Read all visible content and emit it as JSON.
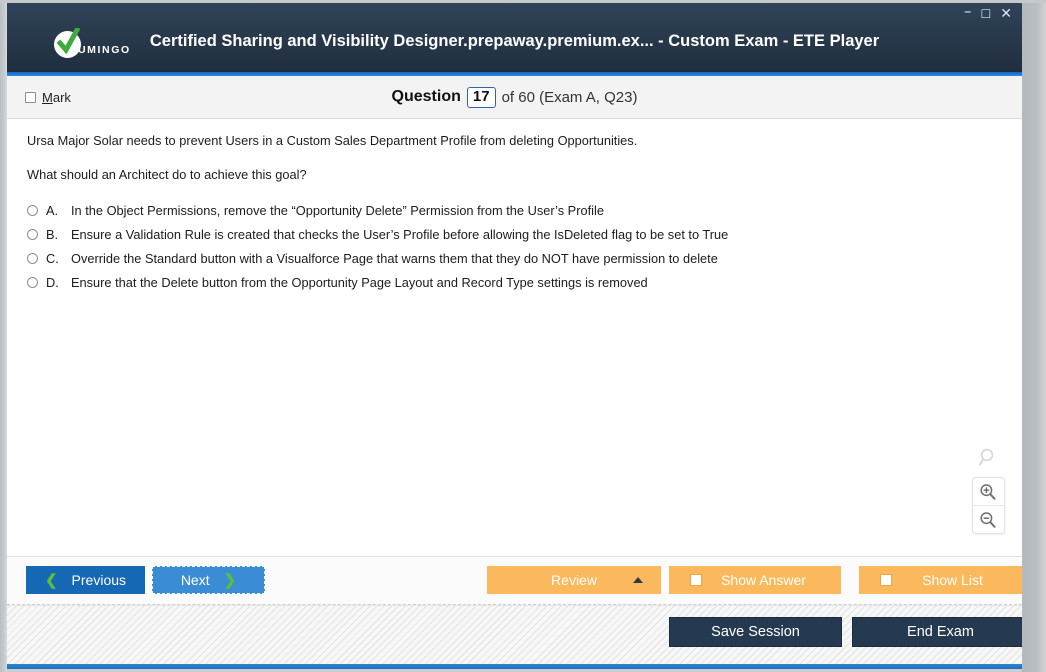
{
  "window": {
    "title": "Certified Sharing and Visibility Designer.prepaway.premium.ex... - Custom Exam - ETE Player",
    "logo_text": "UMINGO",
    "controls": {
      "minimize": "–",
      "maximize": "☐",
      "close": "✕"
    }
  },
  "header": {
    "mark_label_prefix": "M",
    "mark_label_rest": "ark",
    "question_word": "Question",
    "question_number": "17",
    "question_rest": "of 60 (Exam A, Q23)"
  },
  "question": {
    "stem_lines": [
      "Ursa Major Solar needs to prevent Users in a Custom Sales Department Profile from deleting Opportunities.",
      "What should an Architect do to achieve this goal?"
    ],
    "options": [
      {
        "letter": "A.",
        "text": "In the Object Permissions, remove the “Opportunity Delete” Permission from the User’s Profile",
        "selected": false
      },
      {
        "letter": "B.",
        "text": "Ensure a Validation Rule is created that checks the User’s Profile before allowing the IsDeleted flag to be set to True",
        "selected": false
      },
      {
        "letter": "C.",
        "text": "Override the Standard button with a Visualforce Page that warns them that they do NOT have permission to delete",
        "selected": false
      },
      {
        "letter": "D.",
        "text": "Ensure that the Delete button from the Opportunity Page Layout and Record Type settings is removed",
        "selected": false
      }
    ]
  },
  "zoom_tools": {
    "search_icon": "magnifier-icon",
    "zoom_in_icon": "magnifier-plus-icon",
    "zoom_out_icon": "magnifier-minus-icon"
  },
  "toolbar": {
    "previous_label": "Previous",
    "previous_chevron": "❮",
    "next_label": "Next",
    "next_chevron": "❯",
    "review_label": "Review",
    "show_answer_label": "Show Answer",
    "show_list_label": "Show List",
    "show_answer_checked": false,
    "show_list_checked": false
  },
  "statusbar": {
    "save_session_label": "Save Session",
    "end_exam_label": "End Exam"
  },
  "colors": {
    "titlebar_dark": "#2a3b4e",
    "accent_blue": "#1f7ad6",
    "primary_blue": "#1568b4",
    "next_blue": "#3a8dd5",
    "orange": "#fbb85c",
    "green_chevron": "#5bbf3b",
    "dark_navy_button": "#253a50"
  }
}
